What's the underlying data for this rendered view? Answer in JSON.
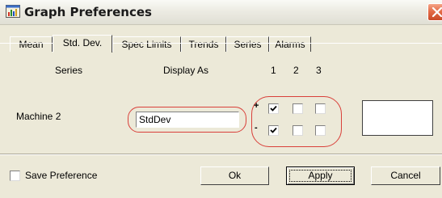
{
  "window": {
    "title": "Graph Preferences",
    "icon": "graph-app-icon",
    "close_icon": "close-icon"
  },
  "tabs": [
    {
      "label": "Mean",
      "active": false
    },
    {
      "label": "Std. Dev.",
      "active": true
    },
    {
      "label": "Spec Limits",
      "active": false
    },
    {
      "label": "Trends",
      "active": false
    },
    {
      "label": "Series",
      "active": false
    },
    {
      "label": "Alarms",
      "active": false
    }
  ],
  "headers": {
    "series": "Series",
    "display_as": "Display As",
    "col1": "1",
    "col2": "2",
    "col3": "3"
  },
  "row": {
    "series_name": "Machine 2",
    "display_as_value": "StdDev",
    "plus_sign": "+",
    "minus_sign": "-",
    "plus_checks": [
      true,
      false,
      false
    ],
    "minus_checks": [
      true,
      false,
      false
    ]
  },
  "footer": {
    "save_preference_label": "Save Preference",
    "save_preference_checked": false,
    "ok_label": "Ok",
    "apply_label": "Apply",
    "cancel_label": "Cancel"
  },
  "colors": {
    "dialog_bg": "#ece9d8",
    "highlight_oval": "#d9403a",
    "close_button": "#e36c47"
  }
}
